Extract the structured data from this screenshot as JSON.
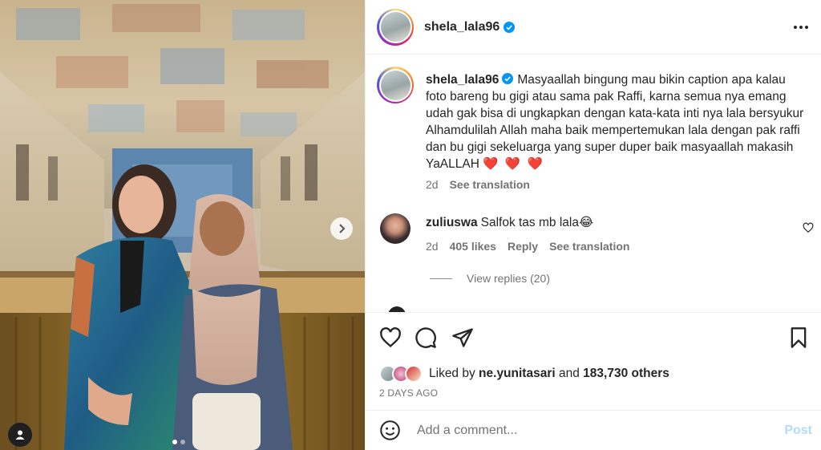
{
  "post": {
    "username": "shela_lala96",
    "verified": true,
    "caption": "Masyaallah bingung mau bikin caption apa kalau foto bareng bu gigi atau sama pak Raffi, karna semua nya emang udah gak bisa di ungkapkan dengan kata-kata inti nya lala bersyukur Alhamdulilah Allah maha baik mempertemukan lala dengan pak raffi dan bu gigi sekeluarga yang super duper baik masyaallah makasih YaALLAH",
    "caption_emoji": "❤️ ❤️ ❤️",
    "caption_time": "2d",
    "see_translation": "See translation",
    "carousel": {
      "total": 2,
      "current": 1
    }
  },
  "comments": [
    {
      "username": "zuliuswa",
      "text": "Salfok tas mb lala😂",
      "time": "2d",
      "likes": "405 likes",
      "reply": "Reply",
      "see_translation": "See translation",
      "view_replies": "View replies (20)"
    }
  ],
  "likes": {
    "prefix": "Liked by",
    "user": "ne.yunitasari",
    "and": "and",
    "others": "183,730 others"
  },
  "date": "2 DAYS AGO",
  "composer": {
    "placeholder": "Add a comment...",
    "post_label": "Post"
  },
  "colors": {
    "link_blue": "#b3dbff",
    "verified_blue": "#0095f6",
    "heart_red": "#ed1c24"
  }
}
